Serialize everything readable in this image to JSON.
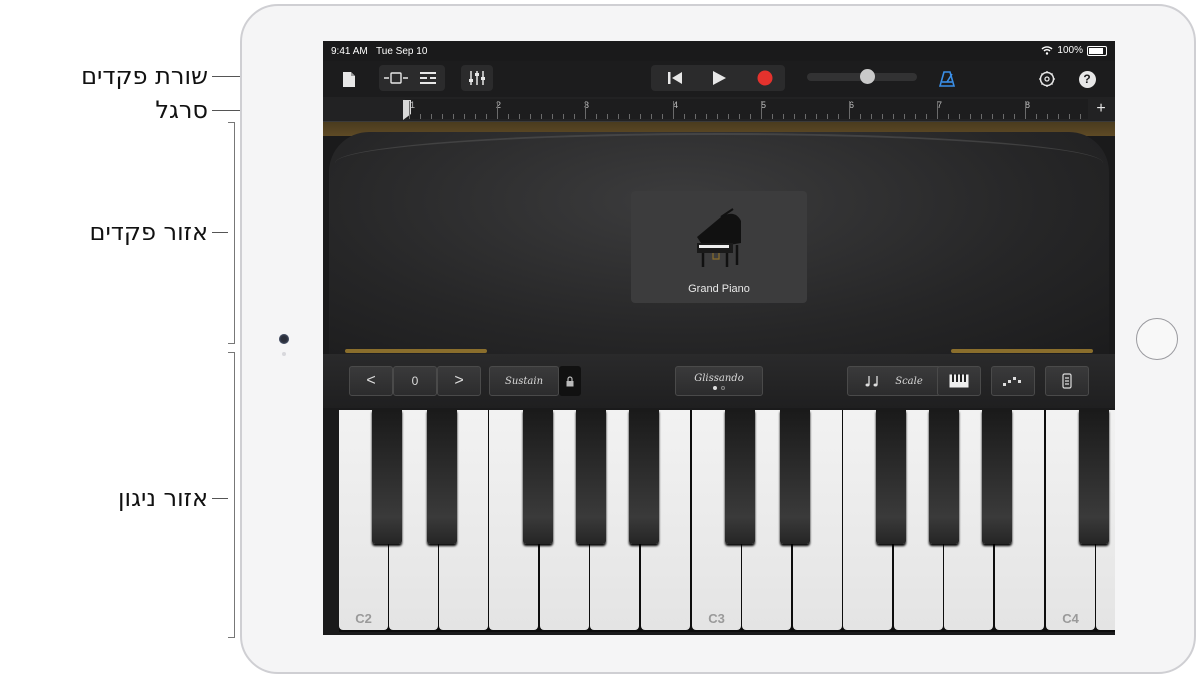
{
  "callouts": {
    "control_bar": "שורת פקדים",
    "ruler": "סרגל",
    "controls_area": "אזור פקדים",
    "play_area": "אזור ניגון"
  },
  "status_bar": {
    "time": "9:41 AM",
    "date": "Tue Sep 10",
    "battery": "100%"
  },
  "control_bar": {
    "icons": [
      "document-icon",
      "view-toggle-icon",
      "tracks-icon",
      "mixer-icon",
      "rewind-icon",
      "play-icon",
      "record-icon",
      "metronome-icon",
      "settings-icon",
      "help-icon"
    ],
    "help_label": "?",
    "record_color": "#e5322d",
    "metronome_color": "#3a8fe8"
  },
  "ruler": {
    "bars": [
      "1",
      "2",
      "3",
      "4",
      "5",
      "6",
      "7",
      "8"
    ],
    "add_label": "+"
  },
  "instrument": {
    "name": "Grand Piano"
  },
  "keyboard_controls": {
    "octave_down": "<",
    "octave_value": "0",
    "octave_up": ">",
    "sustain": "Sustain",
    "glissando": "Glissando",
    "scale": "Scale"
  },
  "keyboard": {
    "labels": {
      "c2": "C2",
      "c3": "C3",
      "c4": "C4"
    }
  }
}
